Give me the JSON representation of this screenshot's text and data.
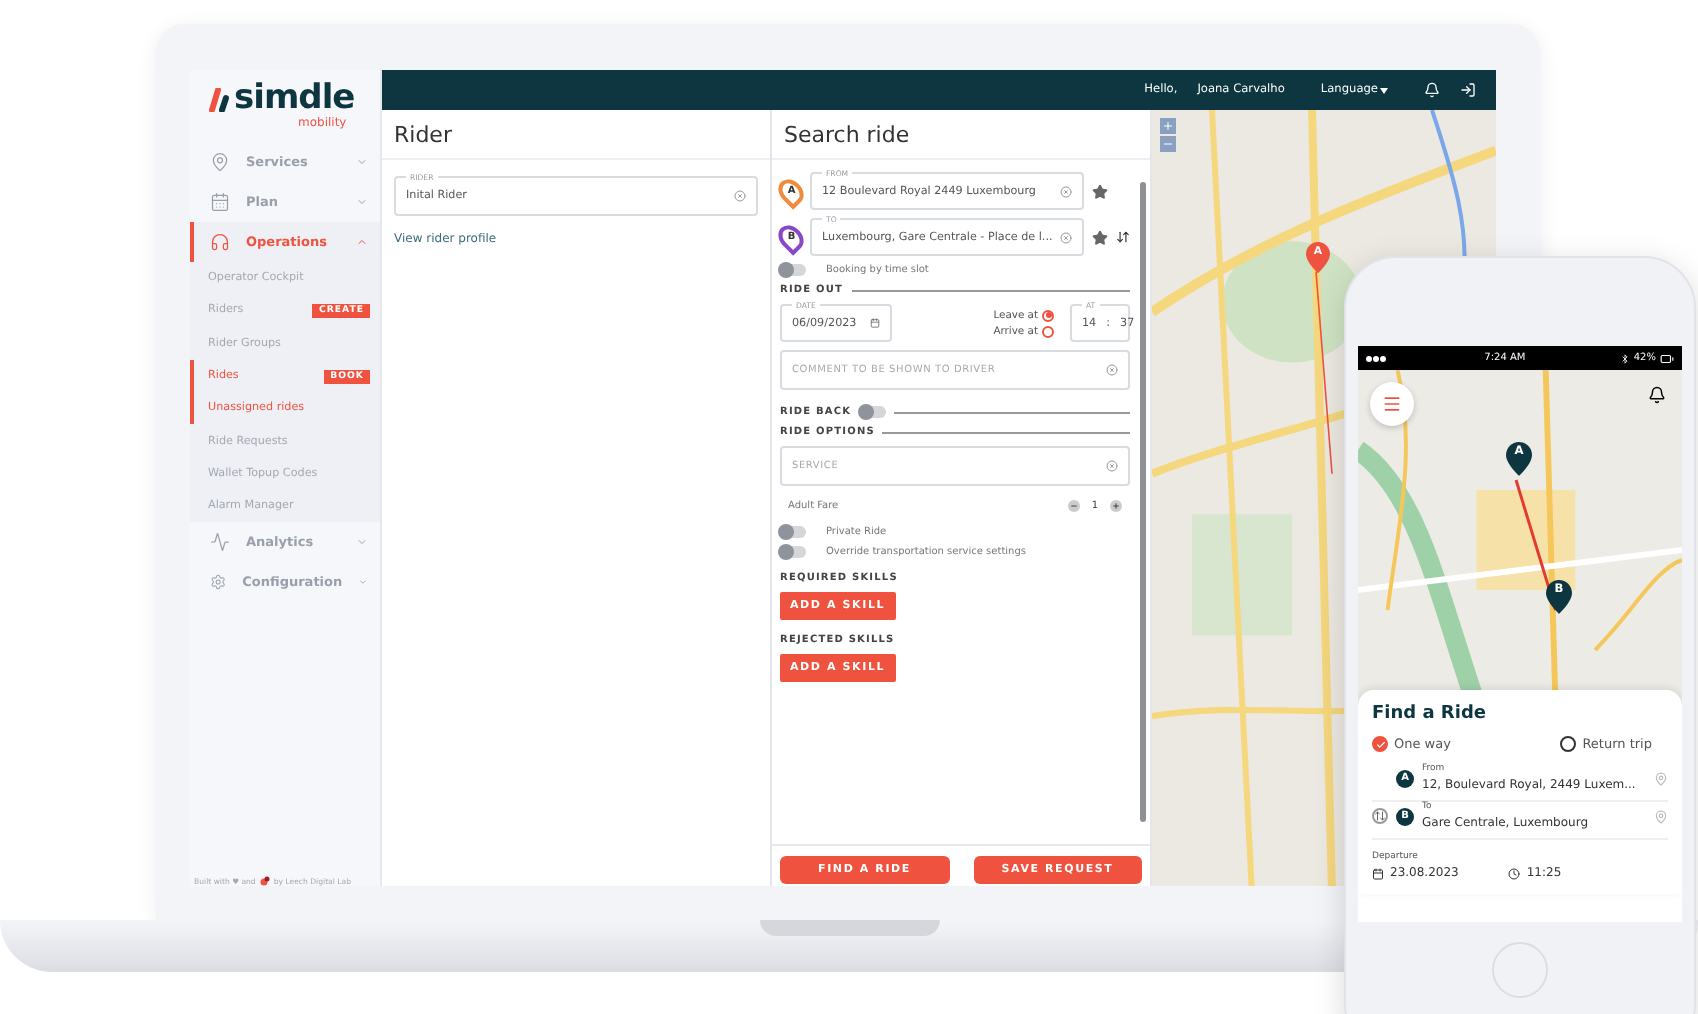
{
  "brand": {
    "name": "simdle",
    "tagline": "mobility"
  },
  "sidebar": {
    "items": [
      {
        "label": "Services",
        "expanded": false,
        "selected": false
      },
      {
        "label": "Plan",
        "expanded": false,
        "selected": false
      },
      {
        "label": "Operations",
        "expanded": true,
        "selected": true,
        "children": [
          {
            "label": "Operator Cockpit",
            "selected": false
          },
          {
            "label": "Riders",
            "selected": false,
            "badge": "CREATE"
          },
          {
            "label": "Rider Groups",
            "selected": false
          },
          {
            "label": "Rides",
            "selected": true,
            "badge": "BOOK"
          },
          {
            "label": "Unassigned rides",
            "selected": true
          },
          {
            "label": "Ride Requests",
            "selected": false
          },
          {
            "label": "Wallet Topup Codes",
            "selected": false
          },
          {
            "label": "Alarm Manager",
            "selected": false
          }
        ]
      },
      {
        "label": "Analytics",
        "expanded": false,
        "selected": false
      },
      {
        "label": "Configuration",
        "expanded": false,
        "selected": false
      }
    ],
    "footer_start": "Built with ♥ and",
    "footer_end": "by Leech Digital Lab"
  },
  "topbar": {
    "greeting": "Hello,",
    "user": "Joana Carvalho",
    "language": "Language"
  },
  "rider": {
    "title": "Rider",
    "field_label": "RIDER",
    "field_value": "Inital Rider",
    "link": "View rider profile"
  },
  "search": {
    "title": "Search ride",
    "from": {
      "marker": "A",
      "label": "FROM",
      "value": "12 Boulevard Royal 2449 Luxembourg"
    },
    "to": {
      "marker": "B",
      "label": "TO",
      "value": "Luxembourg, Gare Centrale - Place de l..."
    },
    "time_slot": {
      "label": "Booking by time slot",
      "on": false
    },
    "ride_out": "RIDE OUT",
    "date": {
      "label": "DATE",
      "value": "06/09/2023"
    },
    "timing": [
      {
        "label": "Leave at",
        "selected": true
      },
      {
        "label": "Arrive at",
        "selected": false
      }
    ],
    "at": {
      "label": "AT",
      "hour": "14",
      "separator": ":",
      "minute": "37"
    },
    "comment_placeholder": "COMMENT TO BE SHOWN TO DRIVER",
    "ride_back": {
      "label": "RIDE BACK",
      "on": false
    },
    "ride_options": "RIDE OPTIONS",
    "service_placeholder": "SERVICE",
    "fare": {
      "label": "Adult Fare",
      "count": "1"
    },
    "toggles": [
      {
        "label": "Private Ride",
        "on": false
      },
      {
        "label": "Override transportation service settings",
        "on": false
      }
    ],
    "skills": [
      {
        "title": "REQUIRED SKILLS",
        "button": "ADD A SKILL"
      },
      {
        "title": "REJECTED SKILLS",
        "button": "ADD A SKILL"
      }
    ],
    "actions": [
      "FIND A RIDE",
      "SAVE REQUEST"
    ]
  },
  "map": {
    "marker": "A"
  },
  "phone": {
    "time": "7:24 AM",
    "battery": "42%",
    "markers": [
      "A",
      "B"
    ],
    "card": {
      "title": "Find a Ride",
      "trip_types": [
        {
          "label": "One way",
          "selected": true
        },
        {
          "label": "Return trip",
          "selected": false
        }
      ],
      "stops": [
        {
          "marker": "A",
          "label": "From",
          "value": "12, Boulevard Royal, 2449 Luxem..."
        },
        {
          "marker": "B",
          "label": "To",
          "value": "Gare Centrale, Luxembourg"
        }
      ],
      "departure_label": "Departure",
      "date": "23.08.2023",
      "time": "11:25"
    }
  }
}
